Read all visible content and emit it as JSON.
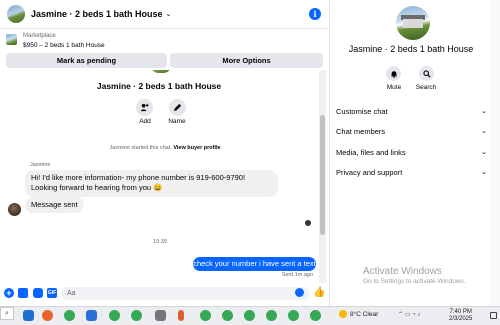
{
  "chat": {
    "header_title": "Jasmine · 2 beds 1 bath House",
    "marketplace_label": "Marketplace",
    "listing_price_title": "$950 – 2 beds 1 bath House",
    "mark_pending_label": "Mark as pending",
    "more_options_label": "More Options",
    "intro_name": "Jasmine · 2 beds 1 bath House",
    "add_label": "Add",
    "name_label": "Name",
    "started_prefix": "Jasmine started this chat.",
    "view_profile_label": "View buyer profile",
    "sender_name": "Jasmine",
    "message1": "Hi! I'd like more information- my phone number is 919-600-9790! Looking forward to hearing from you 😀",
    "message2": "Message sent",
    "timestamp": "19:39",
    "outgoing_message": "check your number i have sent a text",
    "sent_status": "Sent 1m ago",
    "input_placeholder": "Aa"
  },
  "info": {
    "title": "Jasmine · 2 beds 1 bath House",
    "mute_label": "Mute",
    "search_label": "Search",
    "sections": [
      {
        "label": "Customise chat"
      },
      {
        "label": "Chat members"
      },
      {
        "label": "Media, files and links"
      },
      {
        "label": "Privacy and support"
      }
    ]
  },
  "watermark": {
    "heading": "Activate Windows",
    "sub": "Go to Settings to activate Windows."
  },
  "taskbar": {
    "weather": "8°C  Clear",
    "time": "7:40 PM",
    "date": "2/3/2025"
  },
  "colors": {
    "accent": "#0866ff",
    "bubble_in": "#f0f0f0",
    "button_bg": "#e4e6eb"
  }
}
